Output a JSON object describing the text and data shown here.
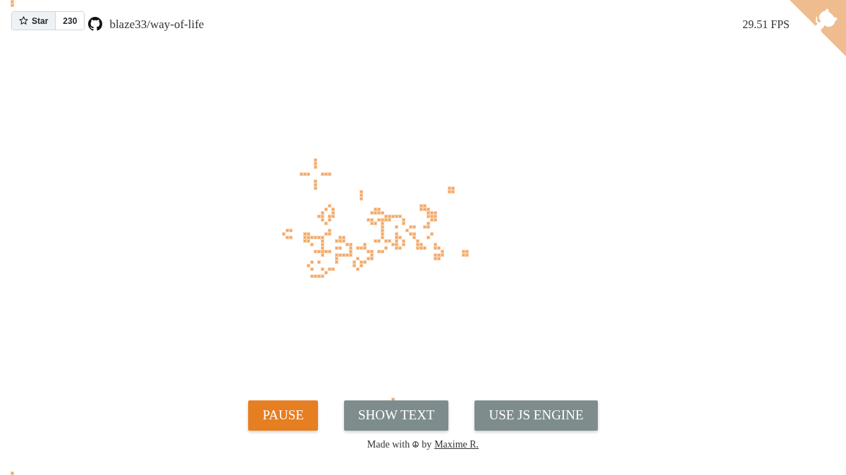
{
  "header": {
    "star_button": {
      "label": "Star",
      "count": "230"
    },
    "repo": "blaze33/way-of-life",
    "fps": "29.51 FPS"
  },
  "buttons": [
    {
      "label": "PAUSE",
      "kind": "primary"
    },
    {
      "label": "SHOW TEXT",
      "kind": "secondary"
    },
    {
      "label": "USE JS ENGINE",
      "kind": "secondary"
    }
  ],
  "footer": {
    "before": "Made with",
    "after": "by",
    "link": "Maxime R."
  }
}
